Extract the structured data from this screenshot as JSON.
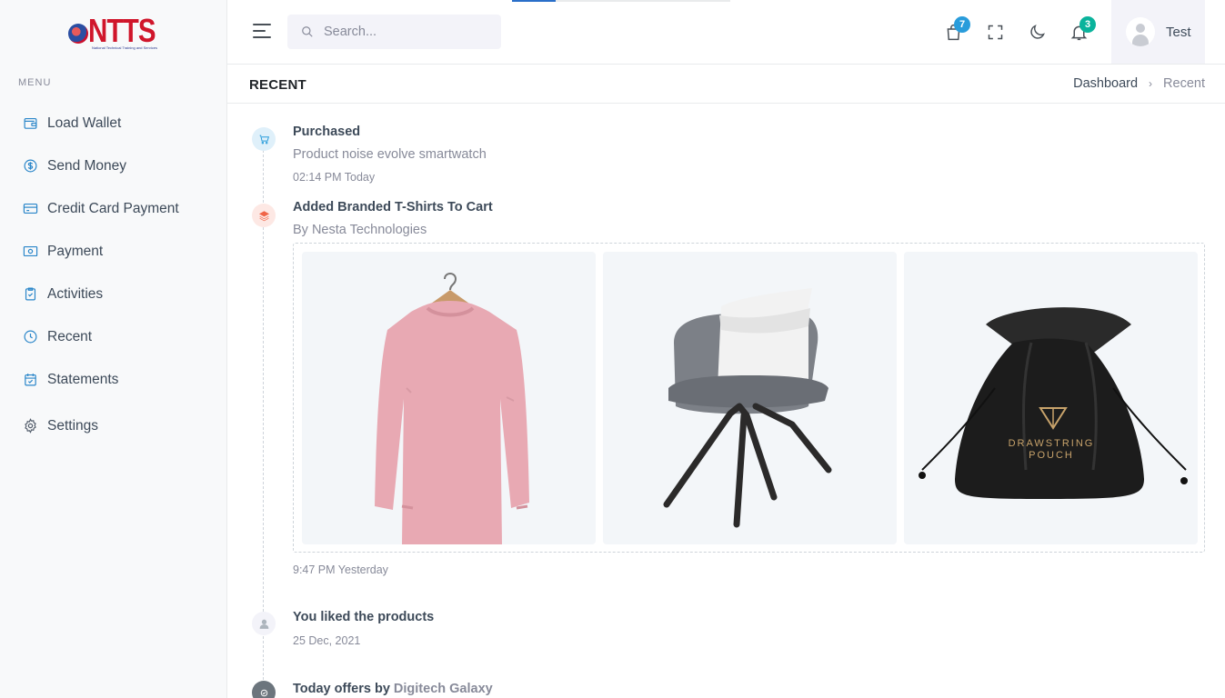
{
  "brand": {
    "name": "NTTS",
    "tagline": "National Technical Training and Services"
  },
  "sidebar": {
    "menu_title": "MENU",
    "items": [
      {
        "label": "Load Wallet",
        "icon": "wallet-icon"
      },
      {
        "label": "Send Money",
        "icon": "dollar-circle-icon"
      },
      {
        "label": "Credit Card Payment",
        "icon": "credit-card-icon"
      },
      {
        "label": "Payment",
        "icon": "cash-icon"
      },
      {
        "label": "Activities",
        "icon": "clipboard-check-icon"
      },
      {
        "label": "Recent",
        "icon": "clock-icon"
      },
      {
        "label": "Statements",
        "icon": "calendar-check-icon"
      },
      {
        "label": "Settings",
        "icon": "gear-icon"
      }
    ]
  },
  "topbar": {
    "search": {
      "placeholder": "Search..."
    },
    "cart_count": "7",
    "notification_count": "3",
    "user_name": "Test",
    "page_progress": 0.2
  },
  "page": {
    "title": "RECENT",
    "breadcrumb": {
      "parent": "Dashboard",
      "current": "Recent"
    }
  },
  "timeline": [
    {
      "title": "Purchased",
      "subtitle": "Product noise evolve smartwatch",
      "time": "02:14 PM Today",
      "icon": "cart-icon"
    },
    {
      "title": "Added Branded T-Shirts To Cart",
      "subtitle": "By Nesta Technologies",
      "time": "9:47 PM Yesterday",
      "icon": "layers-icon",
      "images": [
        "pink-sweatshirt-image",
        "grey-chair-image",
        "drawstring-pouch-image"
      ]
    },
    {
      "title": "You liked the products",
      "time": "25 Dec, 2021",
      "icon": "user-icon"
    },
    {
      "title_prefix": "Today offers by",
      "title_link": "Digitech Galaxy",
      "icon": "badge-icon"
    }
  ],
  "pouch_text": {
    "line1": "DRAWSTRING",
    "line2": "POUCH"
  },
  "colors": {
    "accent": "#299cdb",
    "danger": "#f06548",
    "success": "#0ab39c",
    "sidebar_icon": "#2a86c9"
  }
}
